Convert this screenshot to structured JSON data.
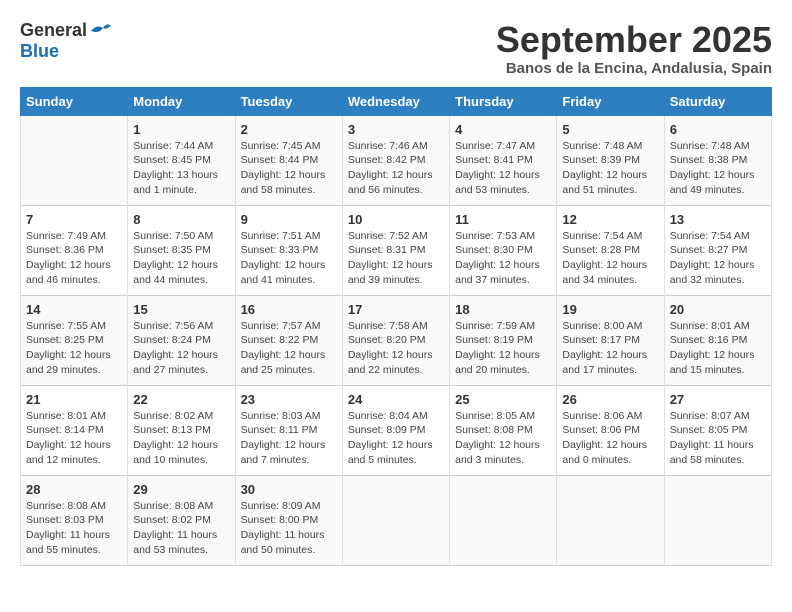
{
  "logo": {
    "general": "General",
    "blue": "Blue"
  },
  "title": "September 2025",
  "location": "Banos de la Encina, Andalusia, Spain",
  "days_of_week": [
    "Sunday",
    "Monday",
    "Tuesday",
    "Wednesday",
    "Thursday",
    "Friday",
    "Saturday"
  ],
  "weeks": [
    [
      {
        "day": "",
        "sunrise": "",
        "sunset": "",
        "daylight": ""
      },
      {
        "day": "1",
        "sunrise": "Sunrise: 7:44 AM",
        "sunset": "Sunset: 8:45 PM",
        "daylight": "Daylight: 13 hours and 1 minute."
      },
      {
        "day": "2",
        "sunrise": "Sunrise: 7:45 AM",
        "sunset": "Sunset: 8:44 PM",
        "daylight": "Daylight: 12 hours and 58 minutes."
      },
      {
        "day": "3",
        "sunrise": "Sunrise: 7:46 AM",
        "sunset": "Sunset: 8:42 PM",
        "daylight": "Daylight: 12 hours and 56 minutes."
      },
      {
        "day": "4",
        "sunrise": "Sunrise: 7:47 AM",
        "sunset": "Sunset: 8:41 PM",
        "daylight": "Daylight: 12 hours and 53 minutes."
      },
      {
        "day": "5",
        "sunrise": "Sunrise: 7:48 AM",
        "sunset": "Sunset: 8:39 PM",
        "daylight": "Daylight: 12 hours and 51 minutes."
      },
      {
        "day": "6",
        "sunrise": "Sunrise: 7:48 AM",
        "sunset": "Sunset: 8:38 PM",
        "daylight": "Daylight: 12 hours and 49 minutes."
      }
    ],
    [
      {
        "day": "7",
        "sunrise": "Sunrise: 7:49 AM",
        "sunset": "Sunset: 8:36 PM",
        "daylight": "Daylight: 12 hours and 46 minutes."
      },
      {
        "day": "8",
        "sunrise": "Sunrise: 7:50 AM",
        "sunset": "Sunset: 8:35 PM",
        "daylight": "Daylight: 12 hours and 44 minutes."
      },
      {
        "day": "9",
        "sunrise": "Sunrise: 7:51 AM",
        "sunset": "Sunset: 8:33 PM",
        "daylight": "Daylight: 12 hours and 41 minutes."
      },
      {
        "day": "10",
        "sunrise": "Sunrise: 7:52 AM",
        "sunset": "Sunset: 8:31 PM",
        "daylight": "Daylight: 12 hours and 39 minutes."
      },
      {
        "day": "11",
        "sunrise": "Sunrise: 7:53 AM",
        "sunset": "Sunset: 8:30 PM",
        "daylight": "Daylight: 12 hours and 37 minutes."
      },
      {
        "day": "12",
        "sunrise": "Sunrise: 7:54 AM",
        "sunset": "Sunset: 8:28 PM",
        "daylight": "Daylight: 12 hours and 34 minutes."
      },
      {
        "day": "13",
        "sunrise": "Sunrise: 7:54 AM",
        "sunset": "Sunset: 8:27 PM",
        "daylight": "Daylight: 12 hours and 32 minutes."
      }
    ],
    [
      {
        "day": "14",
        "sunrise": "Sunrise: 7:55 AM",
        "sunset": "Sunset: 8:25 PM",
        "daylight": "Daylight: 12 hours and 29 minutes."
      },
      {
        "day": "15",
        "sunrise": "Sunrise: 7:56 AM",
        "sunset": "Sunset: 8:24 PM",
        "daylight": "Daylight: 12 hours and 27 minutes."
      },
      {
        "day": "16",
        "sunrise": "Sunrise: 7:57 AM",
        "sunset": "Sunset: 8:22 PM",
        "daylight": "Daylight: 12 hours and 25 minutes."
      },
      {
        "day": "17",
        "sunrise": "Sunrise: 7:58 AM",
        "sunset": "Sunset: 8:20 PM",
        "daylight": "Daylight: 12 hours and 22 minutes."
      },
      {
        "day": "18",
        "sunrise": "Sunrise: 7:59 AM",
        "sunset": "Sunset: 8:19 PM",
        "daylight": "Daylight: 12 hours and 20 minutes."
      },
      {
        "day": "19",
        "sunrise": "Sunrise: 8:00 AM",
        "sunset": "Sunset: 8:17 PM",
        "daylight": "Daylight: 12 hours and 17 minutes."
      },
      {
        "day": "20",
        "sunrise": "Sunrise: 8:01 AM",
        "sunset": "Sunset: 8:16 PM",
        "daylight": "Daylight: 12 hours and 15 minutes."
      }
    ],
    [
      {
        "day": "21",
        "sunrise": "Sunrise: 8:01 AM",
        "sunset": "Sunset: 8:14 PM",
        "daylight": "Daylight: 12 hours and 12 minutes."
      },
      {
        "day": "22",
        "sunrise": "Sunrise: 8:02 AM",
        "sunset": "Sunset: 8:13 PM",
        "daylight": "Daylight: 12 hours and 10 minutes."
      },
      {
        "day": "23",
        "sunrise": "Sunrise: 8:03 AM",
        "sunset": "Sunset: 8:11 PM",
        "daylight": "Daylight: 12 hours and 7 minutes."
      },
      {
        "day": "24",
        "sunrise": "Sunrise: 8:04 AM",
        "sunset": "Sunset: 8:09 PM",
        "daylight": "Daylight: 12 hours and 5 minutes."
      },
      {
        "day": "25",
        "sunrise": "Sunrise: 8:05 AM",
        "sunset": "Sunset: 8:08 PM",
        "daylight": "Daylight: 12 hours and 3 minutes."
      },
      {
        "day": "26",
        "sunrise": "Sunrise: 8:06 AM",
        "sunset": "Sunset: 8:06 PM",
        "daylight": "Daylight: 12 hours and 0 minutes."
      },
      {
        "day": "27",
        "sunrise": "Sunrise: 8:07 AM",
        "sunset": "Sunset: 8:05 PM",
        "daylight": "Daylight: 11 hours and 58 minutes."
      }
    ],
    [
      {
        "day": "28",
        "sunrise": "Sunrise: 8:08 AM",
        "sunset": "Sunset: 8:03 PM",
        "daylight": "Daylight: 11 hours and 55 minutes."
      },
      {
        "day": "29",
        "sunrise": "Sunrise: 8:08 AM",
        "sunset": "Sunset: 8:02 PM",
        "daylight": "Daylight: 11 hours and 53 minutes."
      },
      {
        "day": "30",
        "sunrise": "Sunrise: 8:09 AM",
        "sunset": "Sunset: 8:00 PM",
        "daylight": "Daylight: 11 hours and 50 minutes."
      },
      {
        "day": "",
        "sunrise": "",
        "sunset": "",
        "daylight": ""
      },
      {
        "day": "",
        "sunrise": "",
        "sunset": "",
        "daylight": ""
      },
      {
        "day": "",
        "sunrise": "",
        "sunset": "",
        "daylight": ""
      },
      {
        "day": "",
        "sunrise": "",
        "sunset": "",
        "daylight": ""
      }
    ]
  ]
}
